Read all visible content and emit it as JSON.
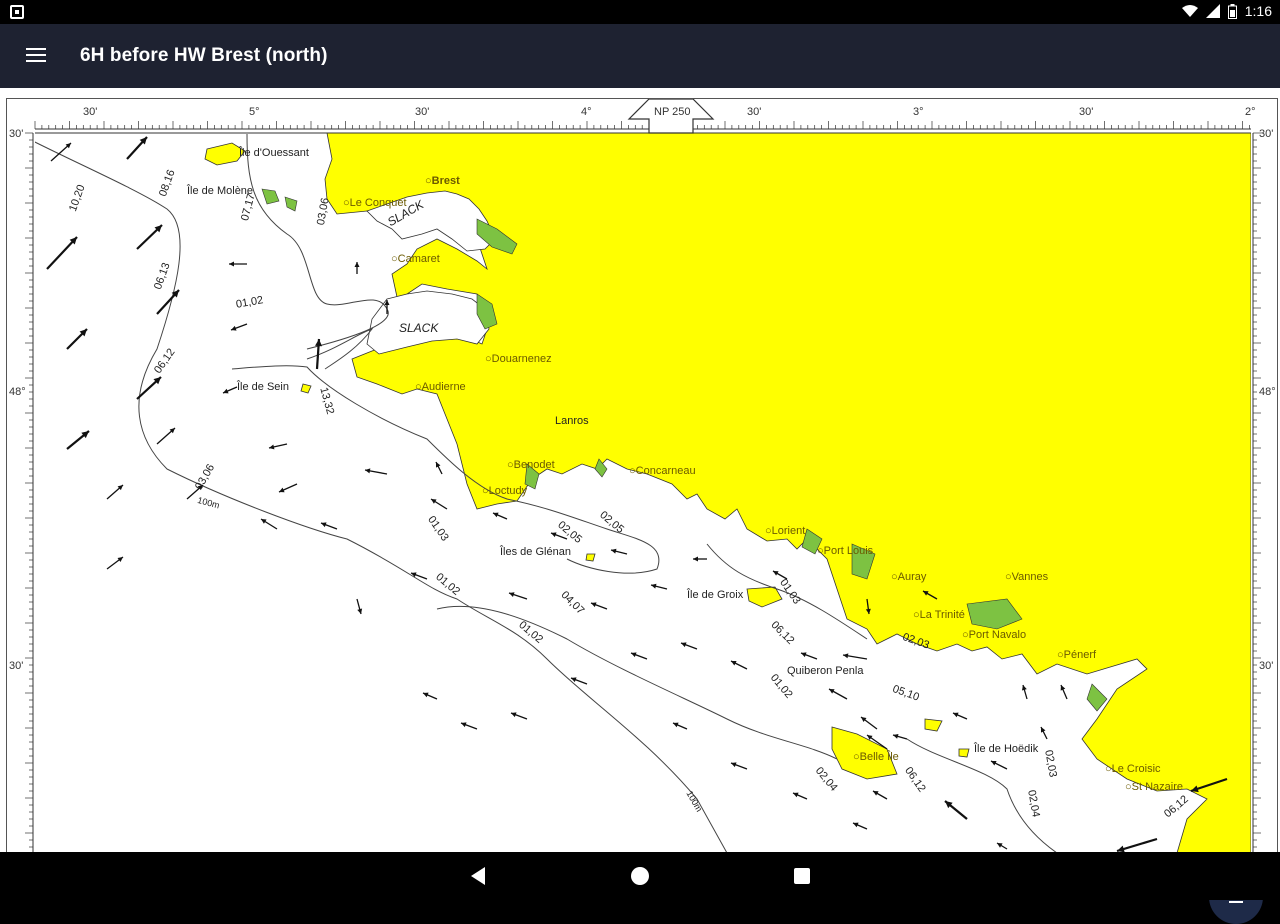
{
  "status": {
    "time": "1:16"
  },
  "appbar": {
    "title": "6H before HW Brest (north)",
    "menu_icon": "hamburger-menu-icon"
  },
  "map": {
    "top_scale_labels": [
      "30'",
      "5°",
      "30'",
      "4°",
      "30'",
      "3°",
      "30'",
      "2°"
    ],
    "chart_ref": "NP 250",
    "left_lat_labels": [
      "30'",
      "48°",
      "30'"
    ],
    "right_lat_labels": [
      "30'",
      "48°",
      "30'"
    ],
    "places": [
      "Île d'Ouessant",
      "Île de Molène",
      "Le Conquet",
      "Brest",
      "Camaret",
      "Douarnenez",
      "Île de Sein",
      "Audierne",
      "Lanros",
      "Benodet",
      "Concarneau",
      "Loctudy",
      "Îles de Glénan",
      "Lorient",
      "Port Louis",
      "Île de Groix",
      "Auray",
      "Vannes",
      "La Trinité",
      "Port Navalo",
      "Quiberon Penla",
      "Pénerf",
      "Belle Île",
      "Île de Hoëdik",
      "Le Croisic",
      "St Nazaire"
    ],
    "rates": [
      "10,20",
      "08,16",
      "07,17",
      "03,06",
      "06,13",
      "01,02",
      "06,12",
      "13,32",
      "03,06",
      "01,03",
      "02,05",
      "02,05",
      "01,02",
      "04,07",
      "01,02",
      "01,03",
      "06,12",
      "01,02",
      "05,10",
      "02,03",
      "02,04",
      "06,12",
      "02,03",
      "02,04",
      "06,12"
    ],
    "slack_labels": [
      "SLACK",
      "SLACK"
    ],
    "depth_labels": [
      "100m",
      "100m"
    ]
  },
  "fab": {
    "icon": "menu-list-icon"
  },
  "colors": {
    "land": "#ffff00",
    "sea": "#ffffff",
    "appbar": "#1e2231",
    "marsh": "#7dc242"
  }
}
